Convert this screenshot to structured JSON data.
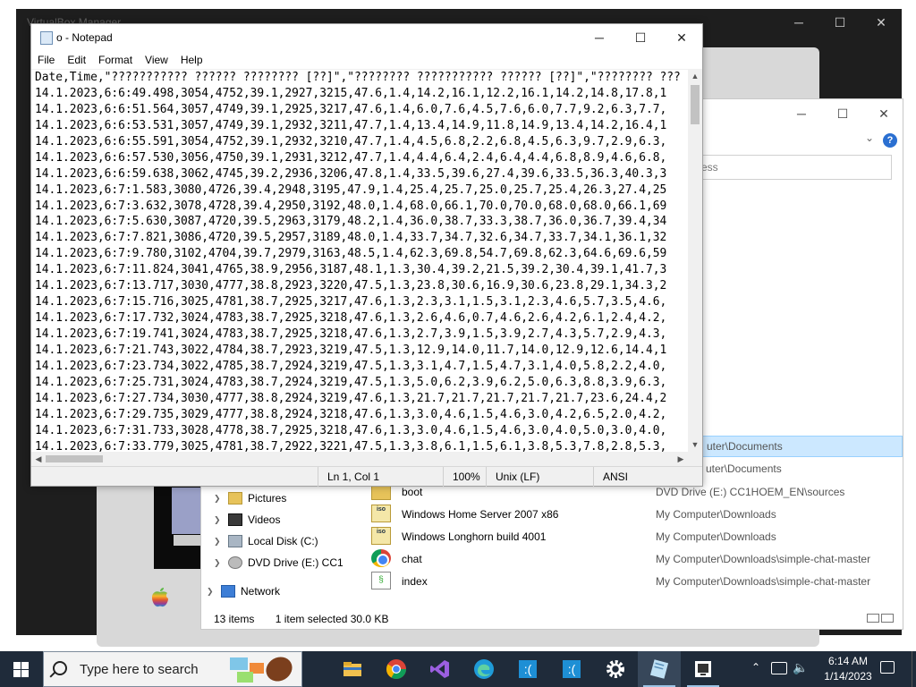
{
  "vm_window": {
    "title": "VirtualBox Manager",
    "minimize": "─",
    "maximize": "☐",
    "close": "✕"
  },
  "explorer": {
    "minimize": "─",
    "maximize": "☐",
    "close": "✕",
    "help": "?",
    "search_placeholder": "ess",
    "nav": [
      {
        "label": "Pictures",
        "icon": "pictures-folder-icon"
      },
      {
        "label": "Videos",
        "icon": "videos-folder-icon"
      },
      {
        "label": "Local Disk (C:)",
        "icon": "local-disk-icon"
      },
      {
        "label": "DVD Drive (E:) CC1",
        "icon": "dvd-drive-icon"
      },
      {
        "label": "Network",
        "icon": "network-icon"
      }
    ],
    "selected_location": "uter\\Documents",
    "second_location": "uter\\Documents",
    "files": [
      {
        "name": "boot",
        "location": "DVD Drive (E:) CC1HOEM_EN\\sources",
        "icon": "folder-icon"
      },
      {
        "name": "Windows Home Server 2007 x86",
        "location": "My Computer\\Downloads",
        "icon": "iso-file-icon"
      },
      {
        "name": "Windows Longhorn build 4001",
        "location": "My Computer\\Downloads",
        "icon": "iso-file-icon"
      },
      {
        "name": "chat",
        "location": "My Computer\\Downloads\\simple-chat-master",
        "icon": "chrome-icon"
      },
      {
        "name": "index",
        "location": "My Computer\\Downloads\\simple-chat-master",
        "icon": "script-file-icon"
      }
    ],
    "status_items": "13 items",
    "status_selected": "1 item selected  30.0 KB"
  },
  "notepad": {
    "title": "o - Notepad",
    "minimize": "─",
    "maximize": "☐",
    "close": "✕",
    "menu": [
      "File",
      "Edit",
      "Format",
      "View",
      "Help"
    ],
    "lines": [
      "Date,Time,\"??????????? ?????? ???????? [??]\",\"???????? ??????????? ?????? [??]\",\"???????? ???",
      "14.1.2023,6:6:49.498,3054,4752,39.1,2927,3215,47.6,1.4,14.2,16.1,12.2,16.1,14.2,14.8,17.8,1",
      "14.1.2023,6:6:51.564,3057,4749,39.1,2925,3217,47.6,1.4,6.0,7.6,4.5,7.6,6.0,7.7,9.2,6.3,7.7,",
      "14.1.2023,6:6:53.531,3057,4749,39.1,2932,3211,47.7,1.4,13.4,14.9,11.8,14.9,13.4,14.2,16.4,1",
      "14.1.2023,6:6:55.591,3054,4752,39.1,2932,3210,47.7,1.4,4.5,6.8,2.2,6.8,4.5,6.3,9.7,2.9,6.3,",
      "14.1.2023,6:6:57.530,3056,4750,39.1,2931,3212,47.7,1.4,4.4,6.4,2.4,6.4,4.4,6.8,8.9,4.6,6.8,",
      "14.1.2023,6:6:59.638,3062,4745,39.2,2936,3206,47.8,1.4,33.5,39.6,27.4,39.6,33.5,36.3,40.3,3",
      "14.1.2023,6:7:1.583,3080,4726,39.4,2948,3195,47.9,1.4,25.4,25.7,25.0,25.7,25.4,26.3,27.4,25",
      "14.1.2023,6:7:3.632,3078,4728,39.4,2950,3192,48.0,1.4,68.0,66.1,70.0,70.0,68.0,68.0,66.1,69",
      "14.1.2023,6:7:5.630,3087,4720,39.5,2963,3179,48.2,1.4,36.0,38.7,33.3,38.7,36.0,36.7,39.4,34",
      "14.1.2023,6:7:7.821,3086,4720,39.5,2957,3189,48.0,1.4,33.7,34.7,32.6,34.7,33.7,34.1,36.1,32",
      "14.1.2023,6:7:9.780,3102,4704,39.7,2979,3163,48.5,1.4,62.3,69.8,54.7,69.8,62.3,64.6,69.6,59",
      "14.1.2023,6:7:11.824,3041,4765,38.9,2956,3187,48.1,1.3,30.4,39.2,21.5,39.2,30.4,39.1,41.7,3",
      "14.1.2023,6:7:13.717,3030,4777,38.8,2923,3220,47.5,1.3,23.8,30.6,16.9,30.6,23.8,29.1,34.3,2",
      "14.1.2023,6:7:15.716,3025,4781,38.7,2925,3217,47.6,1.3,2.3,3.1,1.5,3.1,2.3,4.6,5.7,3.5,4.6,",
      "14.1.2023,6:7:17.732,3024,4783,38.7,2925,3218,47.6,1.3,2.6,4.6,0.7,4.6,2.6,4.2,6.1,2.4,4.2,",
      "14.1.2023,6:7:19.741,3024,4783,38.7,2925,3218,47.6,1.3,2.7,3.9,1.5,3.9,2.7,4.3,5.7,2.9,4.3,",
      "14.1.2023,6:7:21.743,3022,4784,38.7,2923,3219,47.5,1.3,12.9,14.0,11.7,14.0,12.9,12.6,14.4,1",
      "14.1.2023,6:7:23.734,3022,4785,38.7,2924,3219,47.5,1.3,3.1,4.7,1.5,4.7,3.1,4.0,5.8,2.2,4.0,",
      "14.1.2023,6:7:25.731,3024,4783,38.7,2924,3219,47.5,1.3,5.0,6.2,3.9,6.2,5.0,6.3,8.8,3.9,6.3,",
      "14.1.2023,6:7:27.734,3030,4777,38.8,2924,3219,47.6,1.3,21.7,21.7,21.7,21.7,21.7,23.6,24.4,2",
      "14.1.2023,6:7:29.735,3029,4777,38.8,2924,3218,47.6,1.3,3.0,4.6,1.5,4.6,3.0,4.2,6.5,2.0,4.2,",
      "14.1.2023,6:7:31.733,3028,4778,38.7,2925,3218,47.6,1.3,3.0,4.6,1.5,4.6,3.0,4.0,5.0,3.0,4.0,",
      "14.1.2023,6:7:33.779,3025,4781,38.7,2922,3221,47.5,1.3,3.8,6.1,1.5,6.1,3.8,5.3,7.8,2.8,5.3,"
    ],
    "status": {
      "position": "Ln 1, Col 1",
      "zoom": "100%",
      "line_ending": "Unix (LF)",
      "encoding": "ANSI"
    }
  },
  "taskbar": {
    "search_placeholder": "Type here to search",
    "apps": [
      {
        "name": "file-explorer-taskbar-icon"
      },
      {
        "name": "chrome-taskbar-icon"
      },
      {
        "name": "visual-studio-taskbar-icon"
      },
      {
        "name": "edge-taskbar-icon"
      },
      {
        "name": "sad-face-app-1-taskbar-icon"
      },
      {
        "name": "sad-face-app-2-taskbar-icon"
      },
      {
        "name": "settings-taskbar-icon"
      },
      {
        "name": "notepad-taskbar-icon"
      },
      {
        "name": "virtualbox-taskbar-icon"
      }
    ],
    "time": "6:14 AM",
    "date": "1/14/2023",
    "colors": {
      "taskbar": "#1f2b3a",
      "accent": "#9cc3e5"
    }
  }
}
